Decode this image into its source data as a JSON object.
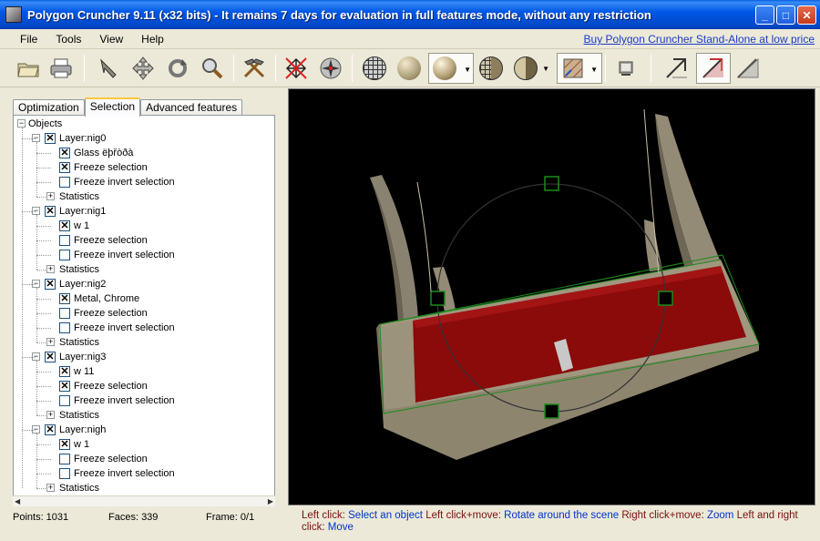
{
  "window": {
    "title": "Polygon Cruncher 9.11 (x32 bits) - It remains 7 days for evaluation in full features mode, without any restriction"
  },
  "menu": {
    "items": [
      "File",
      "Tools",
      "View",
      "Help"
    ],
    "buy_link": "Buy Polygon Cruncher Stand-Alone at low price"
  },
  "toolbar": {
    "buttons": [
      "open-folder-icon",
      "print-icon",
      "select-arrow-icon",
      "move-icon",
      "rotate-icon",
      "zoom-magnifier-icon",
      "hammer-crunch-icon",
      "wireframe-crossed-icon",
      "vertex-star-icon",
      "wireframe-sphere-icon",
      "flat-sphere-icon",
      "smooth-sphere-icon",
      "half-wire-sphere-icon",
      "half-shaded-sphere-icon",
      "texture-icon",
      "snapshot-icon",
      "arrow-gray-icon",
      "arrow-red-icon",
      "arrow-light-icon"
    ],
    "pressed": [
      "smooth-sphere",
      "texture",
      "arrow-red"
    ]
  },
  "tabs": {
    "optimization": "Optimization",
    "selection": "Selection",
    "advanced": "Advanced features",
    "active": "Selection"
  },
  "tree": {
    "root": "Objects",
    "layers": [
      {
        "name": "Layer:nig0",
        "material": "Glass ëþřòðà",
        "material_checked": true,
        "freeze": true,
        "freeze_invert": false,
        "stats": "Statistics"
      },
      {
        "name": "Layer:nig1",
        "material": "w  1",
        "material_checked": true,
        "freeze": false,
        "freeze_invert": false,
        "stats": "Statistics"
      },
      {
        "name": "Layer:nig2",
        "material": "Metal, Chrome",
        "material_checked": true,
        "freeze": false,
        "freeze_invert": false,
        "stats": "Statistics"
      },
      {
        "name": "Layer:nig3",
        "material": "w  11",
        "material_checked": true,
        "freeze": true,
        "freeze_invert": false,
        "stats": "Statistics"
      },
      {
        "name": "Layer:nigh",
        "material": "w  1",
        "material_checked": true,
        "freeze": false,
        "freeze_invert": false,
        "stats": "Statistics"
      }
    ],
    "freeze_label": "Freeze selection",
    "freeze_invert_label": "Freeze invert selection"
  },
  "status": {
    "points": "Points: 1031",
    "faces": "Faces: 339",
    "frame": "Frame: 0/1",
    "help": {
      "left_click": "Left click:",
      "select_object": "Select an object",
      "left_click_move": "Left click+move:",
      "rotate": "Rotate around the scene",
      "right_click_move": "Right click+move:",
      "zoom": "Zoom",
      "left_right": "Left and right click:",
      "move": "Move"
    }
  },
  "colors": {
    "titlebar": "#0058e6",
    "model_wood": "#8a8270",
    "model_red": "#8b0a0a",
    "selection_green": "#1d8a1d"
  }
}
